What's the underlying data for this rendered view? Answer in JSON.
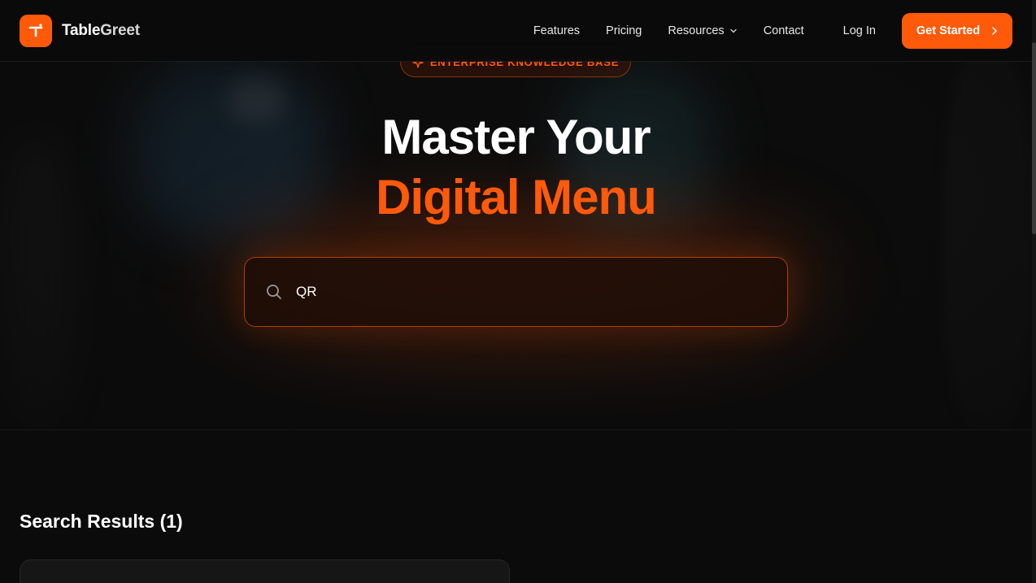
{
  "brand": {
    "name_part1": "Table",
    "name_part2": "Greet",
    "accent_color": "#ff5a0a"
  },
  "nav": {
    "items": [
      {
        "label": "Features"
      },
      {
        "label": "Pricing"
      },
      {
        "label": "Resources",
        "has_dropdown": true
      },
      {
        "label": "Contact"
      }
    ],
    "login_label": "Log In",
    "cta_label": "Get Started"
  },
  "hero": {
    "badge": "ENTERPRISE KNOWLEDGE BASE",
    "title_line1": "Master Your",
    "title_line2": "Digital Menu"
  },
  "search": {
    "value": "QR",
    "icon": "search-icon"
  },
  "results": {
    "title": "Search Results (1)"
  }
}
